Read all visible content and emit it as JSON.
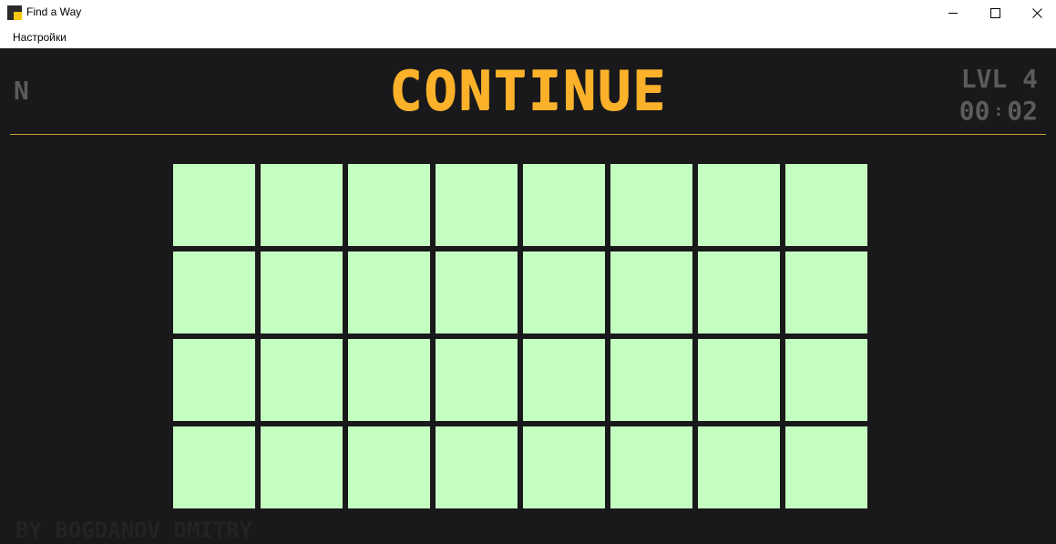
{
  "window": {
    "title": "Find a Way",
    "icon": "app-logo-icon",
    "controls": [
      "minimize-icon",
      "maximize-icon",
      "close-icon"
    ]
  },
  "menu": {
    "settings_label": "Настройки"
  },
  "hud": {
    "sound_label": "N",
    "title": "CONTINUE",
    "level_label": "LVL 4",
    "timer_minutes": "00",
    "timer_separator": ":",
    "timer_seconds": "02"
  },
  "board": {
    "rows": 4,
    "cols": 8,
    "cell_color": "#c5fec1"
  },
  "credits": "BY BOGDANOV DMITRY",
  "colors": {
    "background": "#19191b",
    "accent": "#fbb12a",
    "muted_text": "#5b5b5d",
    "divider": "#c99a2c"
  }
}
